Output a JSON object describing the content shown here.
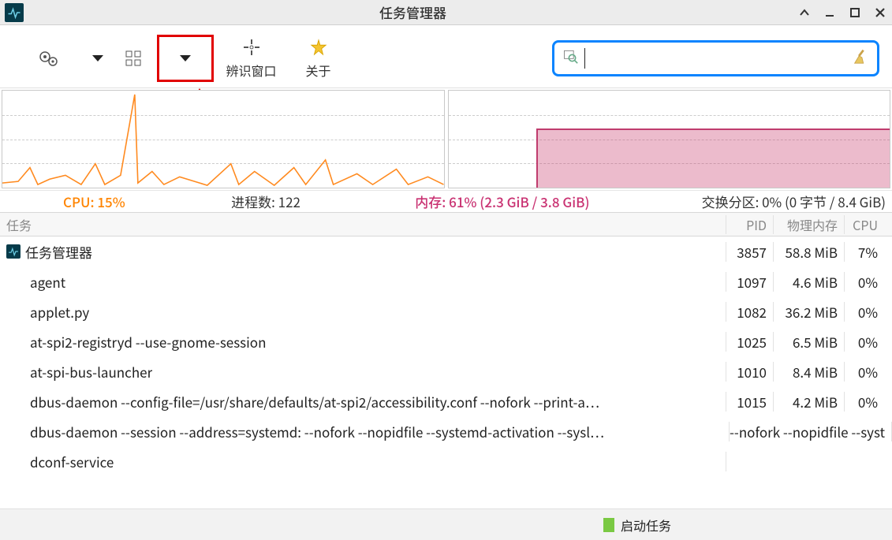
{
  "window": {
    "title": "任务管理器"
  },
  "toolbar": {
    "identify_window": "辨识窗口",
    "about": "关于"
  },
  "search": {
    "placeholder": ""
  },
  "stats": {
    "cpu_label": "CPU: 15%",
    "proc_label": "进程数: 122",
    "mem_label": "内存: 61% (2.3 GiB / 3.8 GiB)",
    "swap_label": "交换分区: 0% (0 字节 / 8.4 GiB)"
  },
  "columns": {
    "task": "任务",
    "pid": "PID",
    "rss": "物理内存",
    "cpu": "CPU"
  },
  "processes": [
    {
      "name": "任务管理器",
      "pid": "3857",
      "rss": "58.8 MiB",
      "cpu": "7%",
      "has_icon": true
    },
    {
      "name": "agent",
      "pid": "1097",
      "rss": "4.6 MiB",
      "cpu": "0%",
      "has_icon": false
    },
    {
      "name": "applet.py",
      "pid": "1082",
      "rss": "36.2 MiB",
      "cpu": "0%",
      "has_icon": false
    },
    {
      "name": "at-spi2-registryd --use-gnome-session",
      "pid": "1025",
      "rss": "6.5 MiB",
      "cpu": "0%",
      "has_icon": false
    },
    {
      "name": "at-spi-bus-launcher",
      "pid": "1010",
      "rss": "8.4 MiB",
      "cpu": "0%",
      "has_icon": false
    },
    {
      "name": "dbus-daemon --config-file=/usr/share/defaults/at-spi2/accessibility.conf --nofork --print-a…",
      "pid": "1015",
      "rss": "4.2 MiB",
      "cpu": "0%",
      "has_icon": false
    },
    {
      "name": "dbus-daemon --session --address=systemd: --nofork --nopidfile --systemd-activation --sysl…",
      "pid": "",
      "rss": "--nofork --nopidfile --syst",
      "cpu": "",
      "has_icon": false,
      "overflow": true
    },
    {
      "name": "dconf-service",
      "pid": "",
      "rss": "",
      "cpu": "",
      "has_icon": false
    }
  ],
  "footer": {
    "start_task": "启动任务"
  },
  "chart_data": [
    {
      "type": "line",
      "title": "CPU",
      "ylim": [
        0,
        100
      ],
      "current_percent": 15,
      "note": "sparkline history, mostly low with one tall spike near left-quarter and several small bursts"
    },
    {
      "type": "area",
      "title": "Memory",
      "ylim": [
        0,
        100
      ],
      "current_percent": 61,
      "used_gib": 2.3,
      "total_gib": 3.8,
      "note": "step up to ~61% around 1/5 from left, then flat"
    }
  ]
}
